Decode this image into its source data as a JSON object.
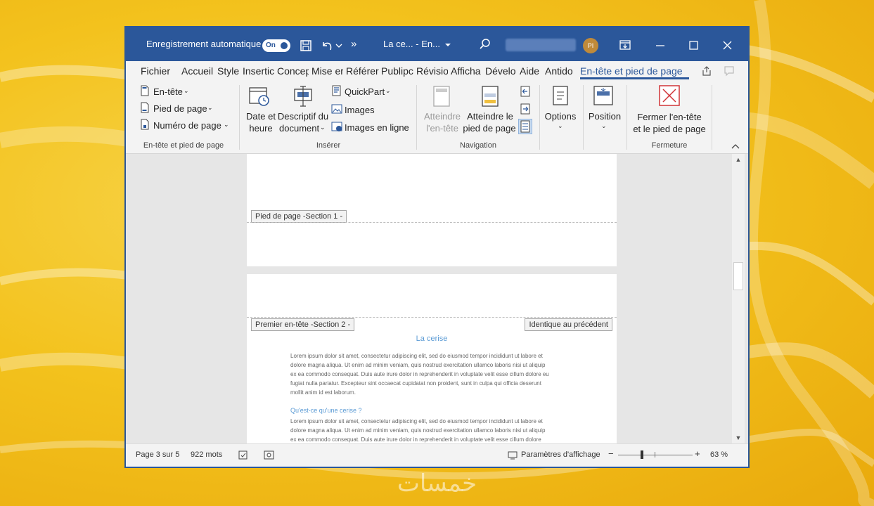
{
  "colors": {
    "accent": "#2b579a",
    "background": "#f3c21d"
  },
  "watermark": "خمسات",
  "titlebar": {
    "autosave_label": "Enregistrement automatique",
    "autosave_toggle": "On",
    "more": "»",
    "doc_name": "La ce... - En...",
    "avatar_initials": "PI"
  },
  "tabs": [
    "Fichier",
    "Accueil",
    "Style",
    "Insertic",
    "Concep",
    "Mise er",
    "Référer",
    "Publipc",
    "Révisio",
    "Afficha",
    "Dévelo",
    "Aide",
    "Antido",
    "En-tête et pied de page"
  ],
  "ribbon": {
    "groups": {
      "hf": {
        "label": "En-tête et pied de page",
        "items": [
          "En-tête",
          "Pied de page",
          "Numéro de page"
        ]
      },
      "insert": {
        "label": "Insérer",
        "date_l1": "Date et",
        "date_l2": "heure",
        "desc_l1": "Descriptif du",
        "desc_l2": "document",
        "quickpart": "QuickPart",
        "images": "Images",
        "images_online": "Images en ligne"
      },
      "nav": {
        "label": "Navigation",
        "goto_header_l1": "Atteindre",
        "goto_header_l2": "l'en-tête",
        "goto_footer_l1": "Atteindre le",
        "goto_footer_l2": "pied de page"
      },
      "options": {
        "label": "Options"
      },
      "position": {
        "label": "Position"
      },
      "close": {
        "label": "Fermeture",
        "btn_l1": "Fermer l'en-tête",
        "btn_l2": "et le pied de page"
      }
    }
  },
  "document": {
    "footer_label": "Pied de page -Section 1 -",
    "first_header_label": "Premier en-tête -Section 2 -",
    "same_as_previous": "Identique au précédent",
    "title": "La cerise",
    "subheading": "Qu'est-ce qu'une cerise ?",
    "para1": [
      "Lorem ipsum dolor sit amet, consectetur adipiscing elit, sed do eiusmod tempor incididunt ut labore et",
      "dolore magna aliqua. Ut enim ad minim veniam, quis nostrud exercitation ullamco laboris nisi ut aliquip",
      "ex ea commodo consequat. Duis aute irure dolor in reprehenderit in voluptate velit esse cillum dolore eu",
      "fugiat nulla pariatur. Excepteur sint occaecat cupidatat non proident, sunt in culpa qui officia deserunt",
      "mollit anim id est laborum."
    ],
    "para2": [
      "Lorem ipsum dolor sit amet, consectetur adipiscing elit, sed do eiusmod tempor incididunt ut labore et",
      "dolore magna aliqua. Ut enim ad minim veniam, quis nostrud exercitation ullamco laboris nisi ut aliquip",
      "ex ea commodo consequat. Duis aute irure dolor in reprehenderit in voluptate velit esse cillum dolore"
    ]
  },
  "status": {
    "page": "Page 3 sur 5",
    "words": "922 mots",
    "display_settings": "Paramètres d'affichage",
    "zoom_minus": "−",
    "zoom_plus": "+",
    "zoom": "63 %",
    "zoom_fraction": 0.32
  }
}
